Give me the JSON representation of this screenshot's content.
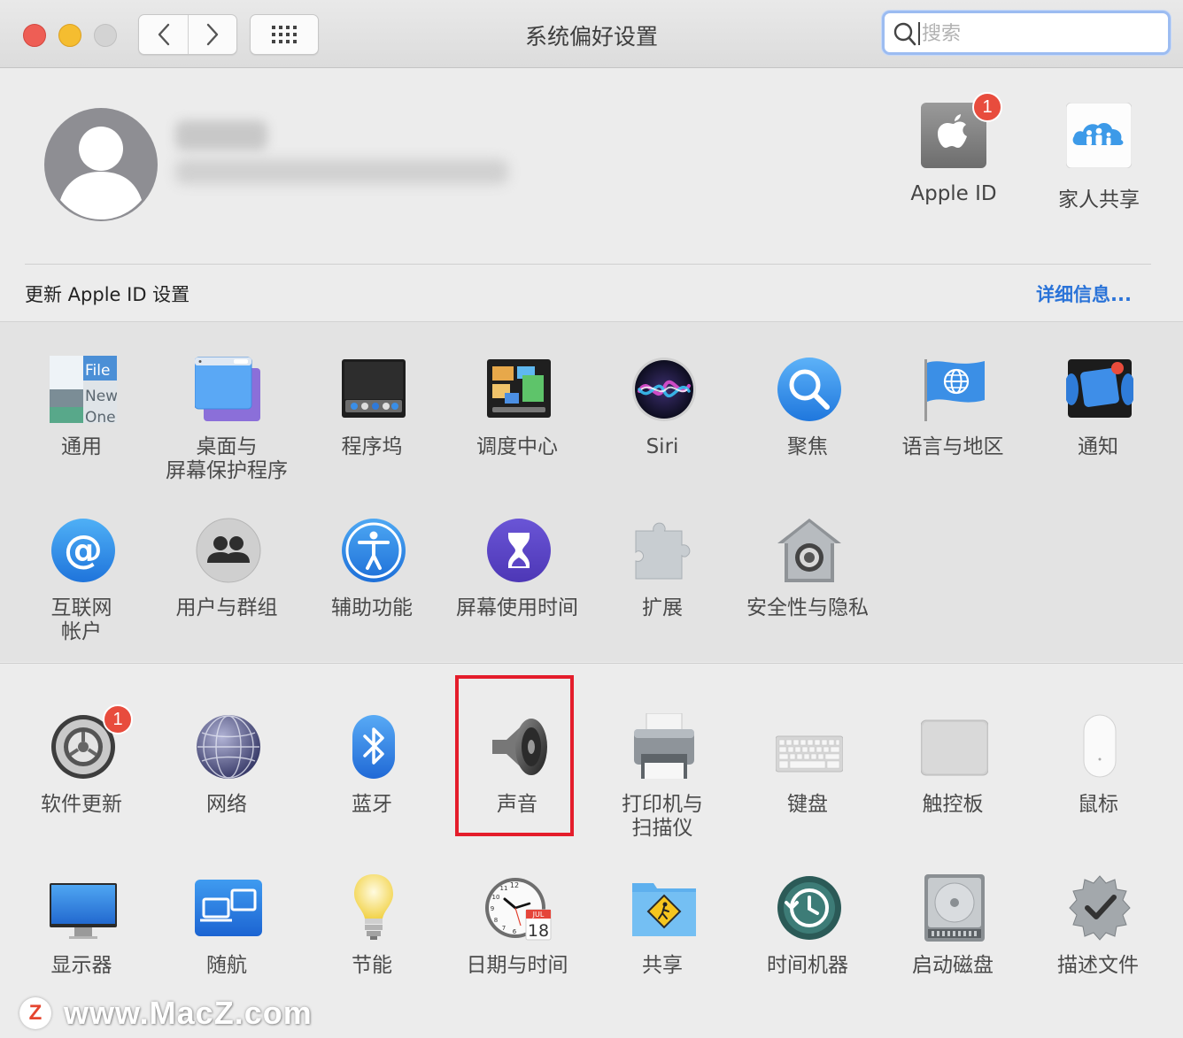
{
  "window": {
    "title": "系统偏好设置"
  },
  "search": {
    "placeholder": "搜索"
  },
  "account": {
    "items": [
      {
        "label": "Apple ID",
        "badge": "1"
      },
      {
        "label": "家人共享"
      }
    ],
    "update_notice": "更新 Apple ID 设置",
    "details_link": "详细信息..."
  },
  "prefs_row1": [
    {
      "label": "通用",
      "icon": "general-icon",
      "icon_text": [
        "File",
        "New",
        "One"
      ]
    },
    {
      "label": "桌面与\n屏幕保护程序",
      "icon": "desktop-screensaver-icon"
    },
    {
      "label": "程序坞",
      "icon": "dock-icon"
    },
    {
      "label": "调度中心",
      "icon": "mission-control-icon"
    },
    {
      "label": "Siri",
      "icon": "siri-icon"
    },
    {
      "label": "聚焦",
      "icon": "spotlight-icon"
    },
    {
      "label": "语言与地区",
      "icon": "language-region-icon"
    },
    {
      "label": "通知",
      "icon": "notifications-icon"
    }
  ],
  "prefs_row2": [
    {
      "label": "互联网\n帐户",
      "icon": "internet-accounts-icon"
    },
    {
      "label": "用户与群组",
      "icon": "users-groups-icon"
    },
    {
      "label": "辅助功能",
      "icon": "accessibility-icon"
    },
    {
      "label": "屏幕使用时间",
      "icon": "screen-time-icon"
    },
    {
      "label": "扩展",
      "icon": "extensions-icon"
    },
    {
      "label": "安全性与隐私",
      "icon": "security-privacy-icon"
    }
  ],
  "prefs_row3": [
    {
      "label": "软件更新",
      "icon": "software-update-icon",
      "badge": "1"
    },
    {
      "label": "网络",
      "icon": "network-icon"
    },
    {
      "label": "蓝牙",
      "icon": "bluetooth-icon"
    },
    {
      "label": "声音",
      "icon": "sound-icon",
      "highlighted": true
    },
    {
      "label": "打印机与\n扫描仪",
      "icon": "printers-scanners-icon"
    },
    {
      "label": "键盘",
      "icon": "keyboard-icon"
    },
    {
      "label": "触控板",
      "icon": "trackpad-icon"
    },
    {
      "label": "鼠标",
      "icon": "mouse-icon"
    }
  ],
  "prefs_row4": [
    {
      "label": "显示器",
      "icon": "displays-icon"
    },
    {
      "label": "随航",
      "icon": "sidecar-icon"
    },
    {
      "label": "节能",
      "icon": "energy-saver-icon"
    },
    {
      "label": "日期与时间",
      "icon": "date-time-icon",
      "icon_text": [
        "JUL",
        "18",
        "12",
        "11",
        "10",
        "9",
        "8",
        "7",
        "6"
      ]
    },
    {
      "label": "共享",
      "icon": "sharing-icon"
    },
    {
      "label": "时间机器",
      "icon": "time-machine-icon"
    },
    {
      "label": "启动磁盘",
      "icon": "startup-disk-icon"
    },
    {
      "label": "描述文件",
      "icon": "profiles-icon"
    }
  ],
  "watermark": {
    "badge": "Z",
    "text": "www.MacZ.com"
  },
  "colors": {
    "close": "#ee5e55",
    "minimize": "#f5bd30",
    "zoom_disabled": "#d3d3d3",
    "link": "#2a73d8",
    "badge": "#e84c3d",
    "highlight": "#e41d2b"
  }
}
